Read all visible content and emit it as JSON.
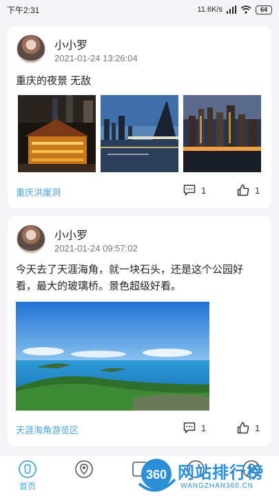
{
  "status_bar": {
    "time": "下午2:31",
    "network_speed": "11.6K/s",
    "battery": "64"
  },
  "posts": [
    {
      "username": "小小罗",
      "timestamp": "2021-01-24 13:26:04",
      "content": "重庆的夜景 无敌",
      "location": "重庆洪崖洞",
      "comments": "1",
      "likes": "1"
    },
    {
      "username": "小小罗",
      "timestamp": "2021-01-24 09:57:02",
      "content": "今天去了天涯海角，就一块石头，还是这个公园好看，最大的玻璃桥。景色超级好看。",
      "location": "天涯海角游览区",
      "comments": "1",
      "likes": "1"
    }
  ],
  "tabbar": {
    "home_label": "首页"
  },
  "watermark": {
    "badge": "360",
    "text": "网站排行榜",
    "url": "WANGZHAN360.CN"
  },
  "colors": {
    "accent": "#4aa4d8",
    "background": "#f4f4f6"
  }
}
